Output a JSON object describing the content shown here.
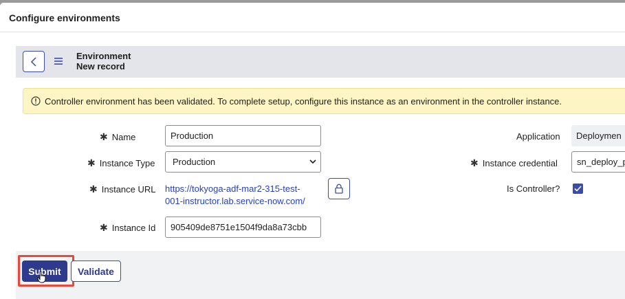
{
  "modal": {
    "title": "Configure environments"
  },
  "form_header": {
    "title": "Environment",
    "subtitle": "New record"
  },
  "notice": {
    "text": "Controller environment has been validated. To complete setup, configure this instance as an environment in the controller instance."
  },
  "fields": {
    "name": {
      "label": "Name",
      "value": "Production",
      "required": true
    },
    "instance_type": {
      "label": "Instance Type",
      "value": "Production",
      "required": true
    },
    "instance_url": {
      "label": "Instance URL",
      "line1": "https://tokyoga-adf-mar2-315-test-",
      "line2": "001-instructor.lab.service-now.com/",
      "required": true
    },
    "instance_id": {
      "label": "Instance Id",
      "value": "905409de8751e1504f9da8a73cbb",
      "required": true
    },
    "application": {
      "label": "Application",
      "value": "Deploymen"
    },
    "instance_credential": {
      "label": "Instance credential",
      "value": "sn_deploy_p",
      "required": true
    },
    "is_controller": {
      "label": "Is Controller?",
      "checked": true
    }
  },
  "footer": {
    "submit_label": "Submit",
    "validate_label": "Validate"
  },
  "colors": {
    "accent": "#2e3a8c",
    "link": "#2742b8",
    "notice_bg": "#fdf6c4",
    "highlight": "#e8473a"
  },
  "icons": {
    "back": "chevron-left-icon",
    "menu": "hamburger-menu-icon",
    "notice": "info-circle-icon",
    "lock": "lock-icon",
    "check": "checkmark-icon",
    "cursor": "hand-pointer-icon"
  }
}
